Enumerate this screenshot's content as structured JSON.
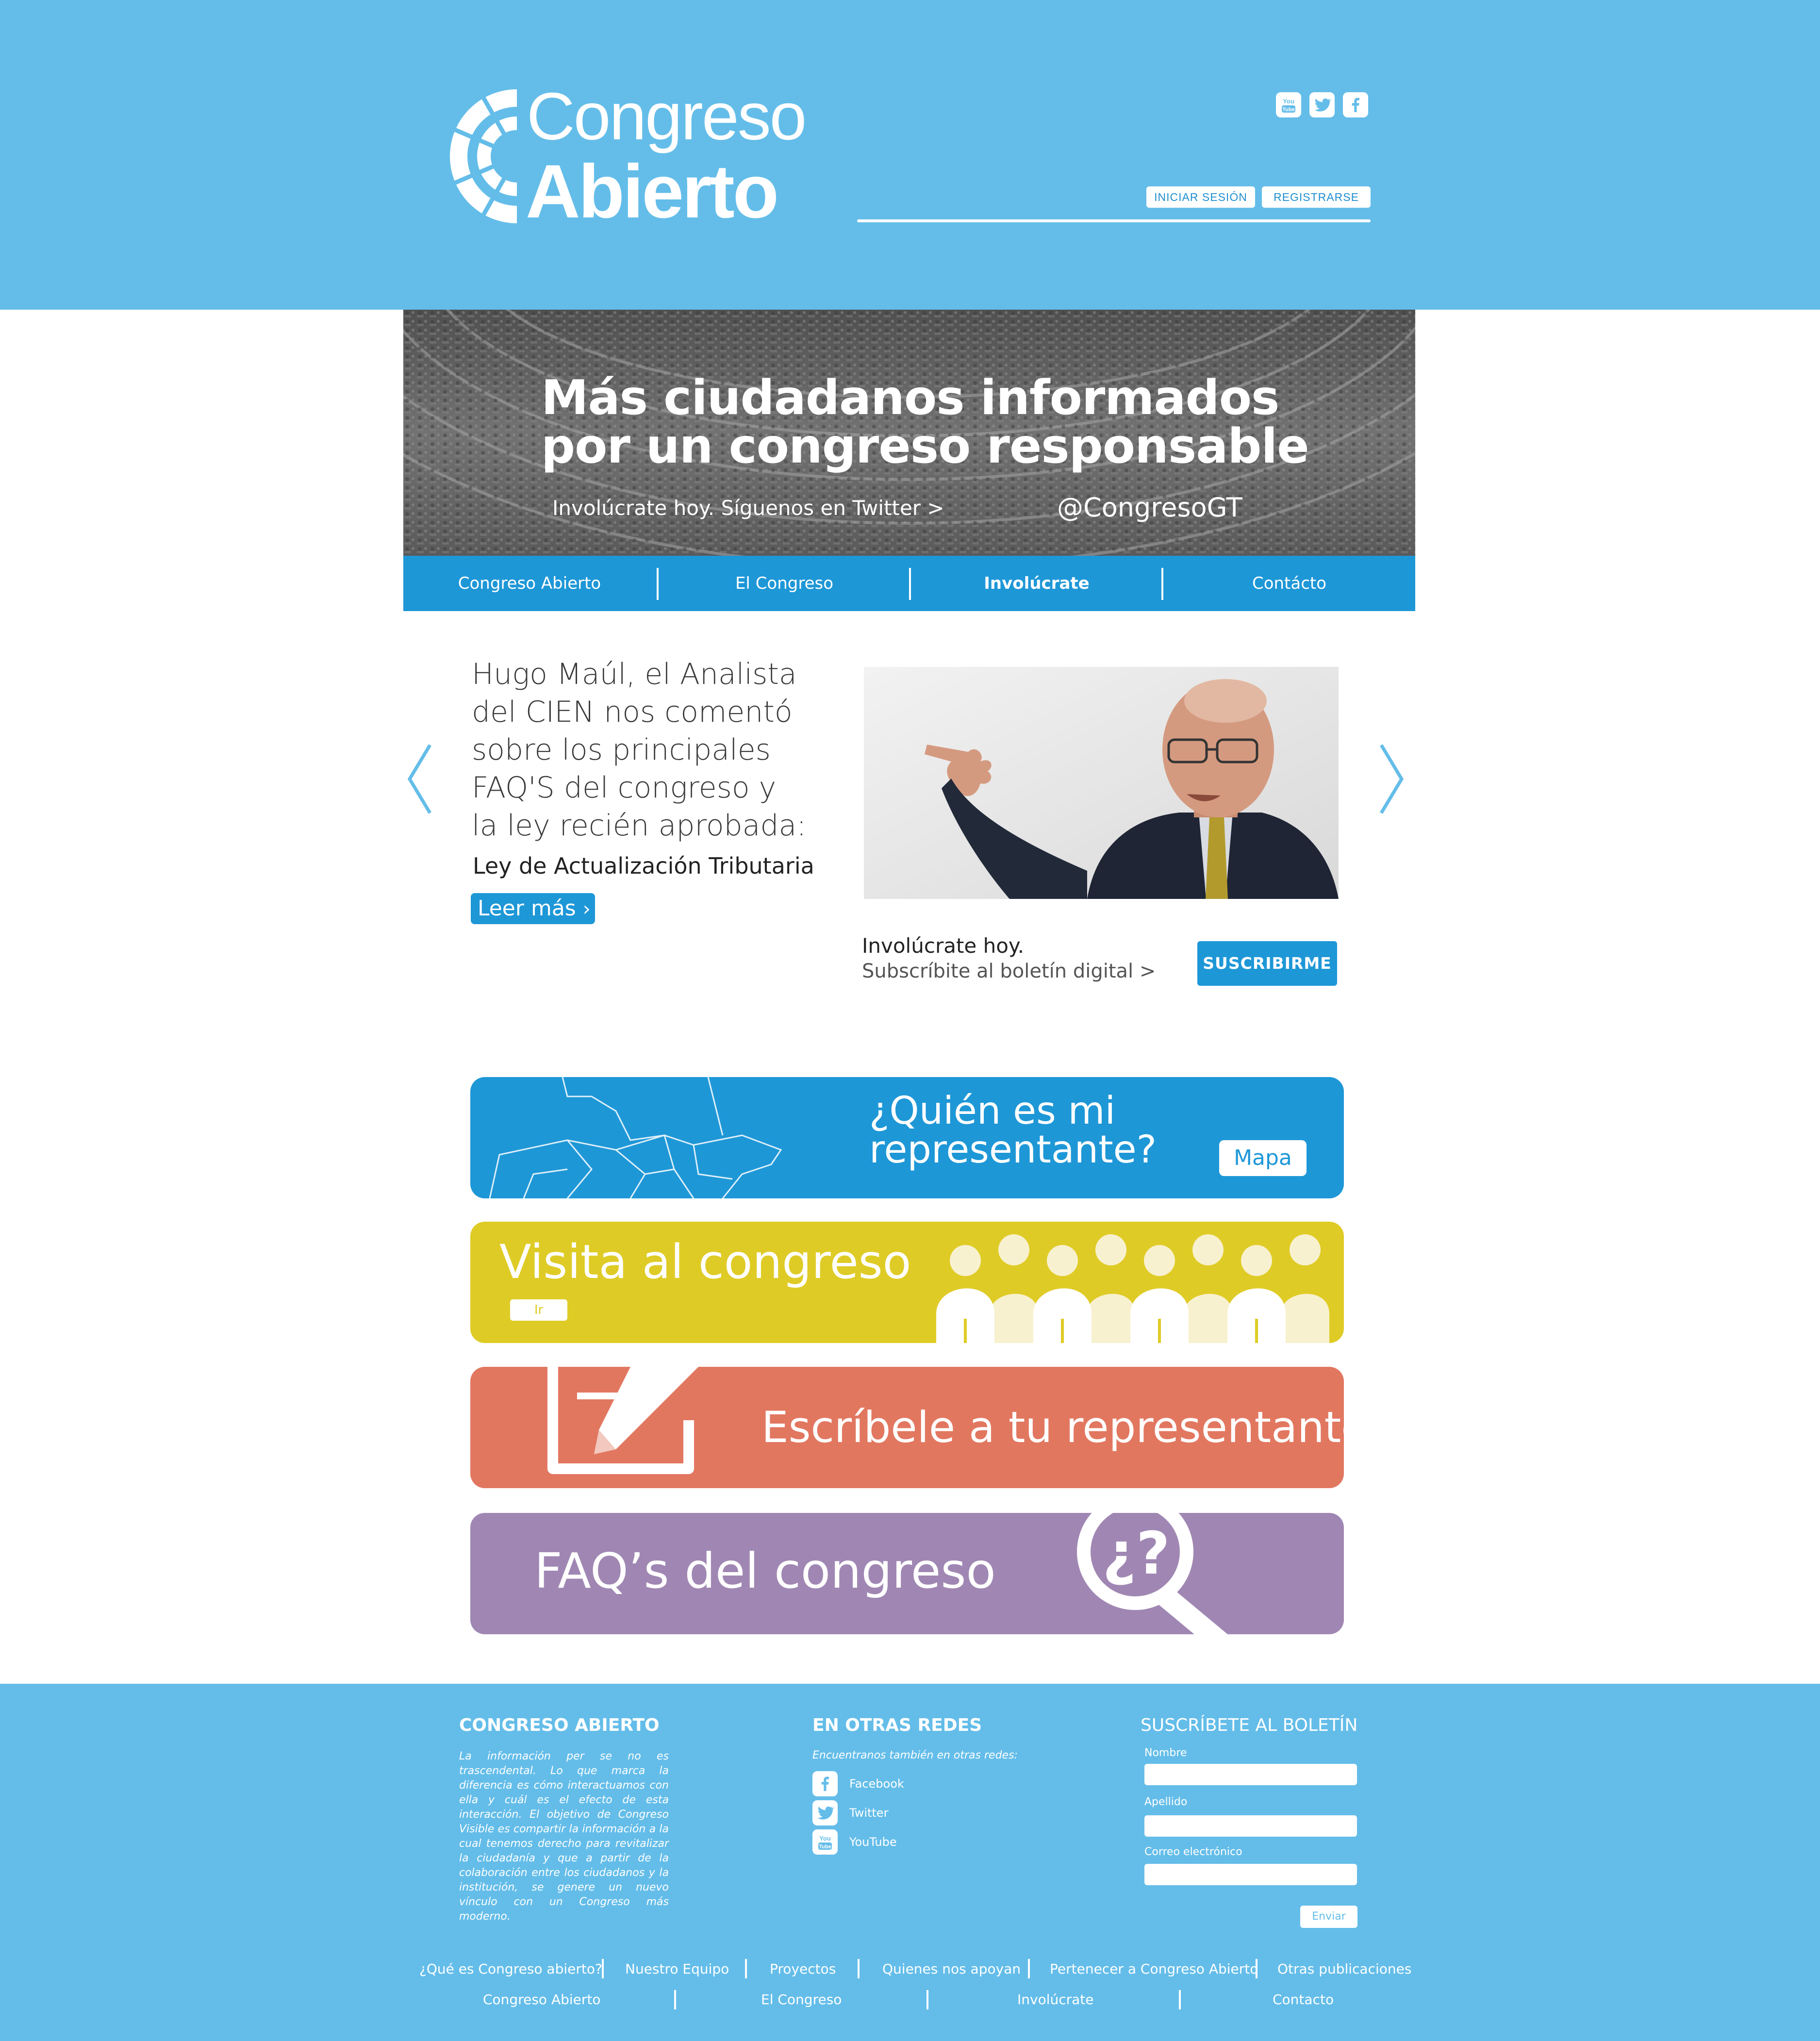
{
  "brand": {
    "line1": "Congreso",
    "line2": "Abierto"
  },
  "header": {
    "social": [
      "youtube-icon",
      "twitter-icon",
      "facebook-icon"
    ],
    "login_label": "INICIAR SESIÓN",
    "register_label": "REGISTRARSE"
  },
  "hero": {
    "title_line1": "Más ciudadanos informados",
    "title_line2": "por un congreso responsable",
    "subtitle": "Involúcrate hoy. Síguenos en Twitter  >",
    "handle": "@CongresoGT"
  },
  "nav": {
    "items": [
      "Congreso Abierto",
      "El Congreso",
      "Involúcrate",
      "Contácto"
    ],
    "active": "Involúcrate"
  },
  "feature": {
    "lines": [
      "Hugo Maúl, el Analista",
      "del CIEN nos comentó",
      "sobre los principales",
      "FAQ'S del congreso y",
      "la ley recién aprobada:"
    ],
    "law": "Ley de Actualización Tributaria",
    "read_more": "Leer más",
    "subscribe_line1": "Involúcrate hoy.",
    "subscribe_line2": "Subscríbite al boletín digital >",
    "subscribe_button": "SUSCRIBIRME"
  },
  "actions": {
    "representative_line1": "¿Quién es mi",
    "representative_line2": "representante?",
    "map_button": "Mapa",
    "visit_label": "Visita al congreso",
    "visit_button": "Ir",
    "write_label": "Escríbele a tu representante",
    "faq_label": "FAQ’s del congreso",
    "faq_glyph": "¿?"
  },
  "footer": {
    "about_title": "CONGRESO ABIERTO",
    "about_text": "La información per se no es trascendental. Lo que marca la diferencia es cómo interactuamos con ella y cuál es el efecto de esta interacción. El objetivo de Congreso Visible es compartir la información a la cual tenemos derecho para revitalizar la ciudadanía y que a partir de la colaboración entre los ciudadanos y la institución, se genere un nuevo vínculo con un Congreso más moderno.",
    "networks_title": "EN OTRAS REDES",
    "networks_intro": "Encuentranos también en otras redes:",
    "networks": [
      "Facebook",
      "Twitter",
      "YouTube"
    ],
    "newsletter_title": "SUSCRÍBETE AL BOLETÍN",
    "fields": [
      "Nombre",
      "Apellido",
      "Correo electrónico"
    ],
    "send_label": "Enviar",
    "links_row1": [
      "¿Qué es Congreso abierto?",
      "Nuestro Equipo",
      "Proyectos",
      "Quienes nos apoyan",
      "Pertenecer a Congreso Abierto",
      "Otras publicaciones"
    ],
    "links_row2": [
      "Congreso Abierto",
      "El Congreso",
      "Involúcrate",
      "Contacto"
    ]
  },
  "colors": {
    "sky": "#64bde9",
    "blue": "#1e97d7",
    "yellow": "#dfcb26",
    "coral": "#e27760",
    "purple": "#a087b3"
  }
}
